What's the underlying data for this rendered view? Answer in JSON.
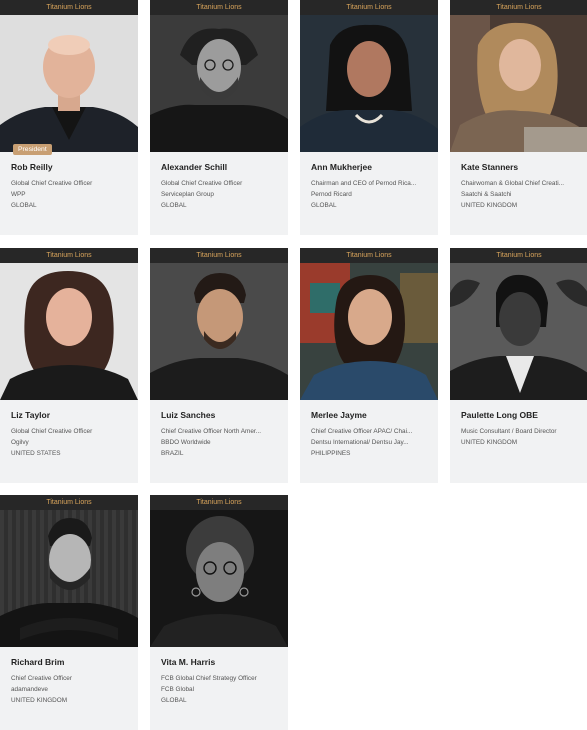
{
  "cards": [
    {
      "tag": "Titanium Lions",
      "name": "Rob Reilly",
      "title": "Global Chief Creative Officer",
      "company": "WPP",
      "country": "GLOBAL",
      "badge": "President"
    },
    {
      "tag": "Titanium Lions",
      "name": "Alexander Schill",
      "title": "Global Chief Creative Officer",
      "company": "Serviceplan Group",
      "country": "GLOBAL"
    },
    {
      "tag": "Titanium Lions",
      "name": "Ann Mukherjee",
      "title": "Chairman and CEO of Pernod Rica...",
      "company": "Pernod Ricard",
      "country": "GLOBAL"
    },
    {
      "tag": "Titanium Lions",
      "name": "Kate Stanners",
      "title": "Chairwoman & Global Chief Creati...",
      "company": "Saatchi & Saatchi",
      "country": "UNITED KINGDOM"
    },
    {
      "tag": "Titanium Lions",
      "name": "Liz Taylor",
      "title": "Global Chief Creative Officer",
      "company": "Ogilvy",
      "country": "UNITED STATES"
    },
    {
      "tag": "Titanium Lions",
      "name": "Luiz Sanches",
      "title": "Chief Creative Officer North Amer...",
      "company": "BBDO Worldwide",
      "country": "BRAZIL"
    },
    {
      "tag": "Titanium Lions",
      "name": "Merlee Jayme",
      "title": "Chief Creative Officer APAC/ Chai...",
      "company": "Dentsu International/ Dentsu Jay...",
      "country": "PHILIPPINES"
    },
    {
      "tag": "Titanium Lions",
      "name": "Paulette Long OBE",
      "title": "Music Consultant / Board Director",
      "company": "UNITED KINGDOM",
      "country": ""
    },
    {
      "tag": "Titanium Lions",
      "name": "Richard Brim",
      "title": "Chief Creative Officer",
      "company": "adamandeve",
      "country": "UNITED KINGDOM"
    },
    {
      "tag": "Titanium Lions",
      "name": "Vita M. Harris",
      "title": "FCB Global Chief Strategy Officer",
      "company": "FCB Global",
      "country": "GLOBAL"
    }
  ],
  "colors": {
    "tag_bar": "#272727",
    "tag_text": "#d8a45b",
    "card_bg": "#f1f2f3",
    "badge": "#c89f73"
  }
}
